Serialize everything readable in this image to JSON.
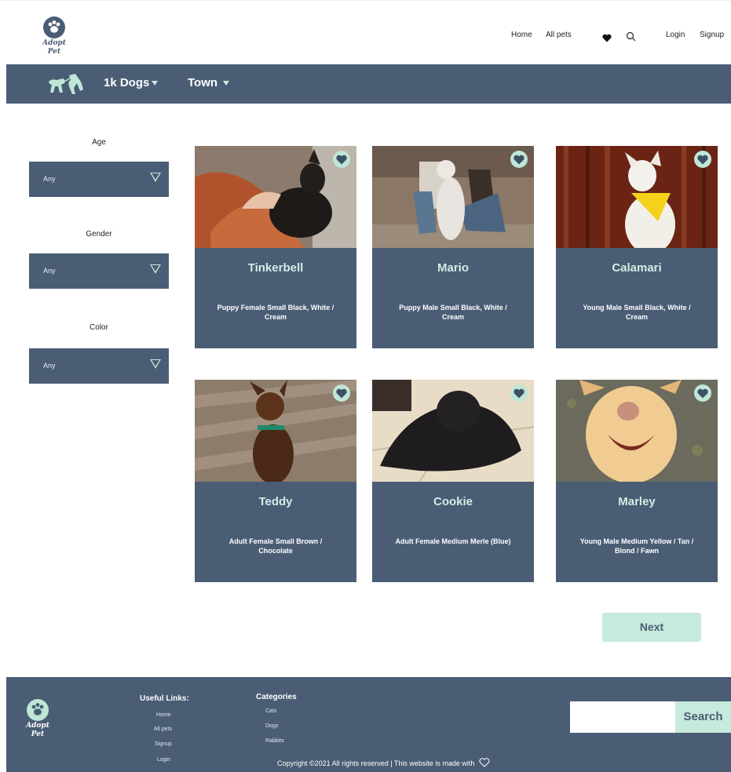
{
  "header": {
    "logo_text_line1": "Adopt",
    "logo_text_line2": "Pet",
    "nav": [
      "Home",
      "All pets"
    ],
    "login": "Login",
    "signup": "Signup"
  },
  "filter_bar": {
    "dogs_label": "1k Dogs",
    "town_label": "Town"
  },
  "filters": [
    {
      "label": "Age",
      "value": "Any"
    },
    {
      "label": "Gender",
      "value": "Any"
    },
    {
      "label": "Color",
      "value": "Any"
    }
  ],
  "pets": [
    {
      "name": "Tinkerbell",
      "desc": "Puppy Female Small Black, White / Cream"
    },
    {
      "name": "Mario",
      "desc": "Puppy Male Small Black, White / Cream"
    },
    {
      "name": "Calamari",
      "desc": "Young Male Small Black, White / Cream"
    },
    {
      "name": "Teddy",
      "desc": "Adult Female Small Brown / Chocolate"
    },
    {
      "name": "Cookie",
      "desc": "Adult Female Medium Merle (Blue)"
    },
    {
      "name": "Marley",
      "desc": "Young Male Medium Yellow / Tan / Blond / Fawn"
    }
  ],
  "next_label": "Next",
  "footer": {
    "logo_text_line1": "Adopt",
    "logo_text_line2": "Pet",
    "useful_links_title": "Useful Links:",
    "useful_links": [
      "Home",
      "All pets",
      "Signup",
      "Login"
    ],
    "categories_title": "Categories",
    "categories": [
      "Cats",
      "Dogs",
      "Rabbits"
    ],
    "search_label": "Search",
    "copyright": "Copyright ©2021 All rights reserved | This website is made with"
  },
  "colors": {
    "primary": "#4a5d75",
    "accent": "#c6eadc",
    "accent_text": "#cfeee3"
  }
}
